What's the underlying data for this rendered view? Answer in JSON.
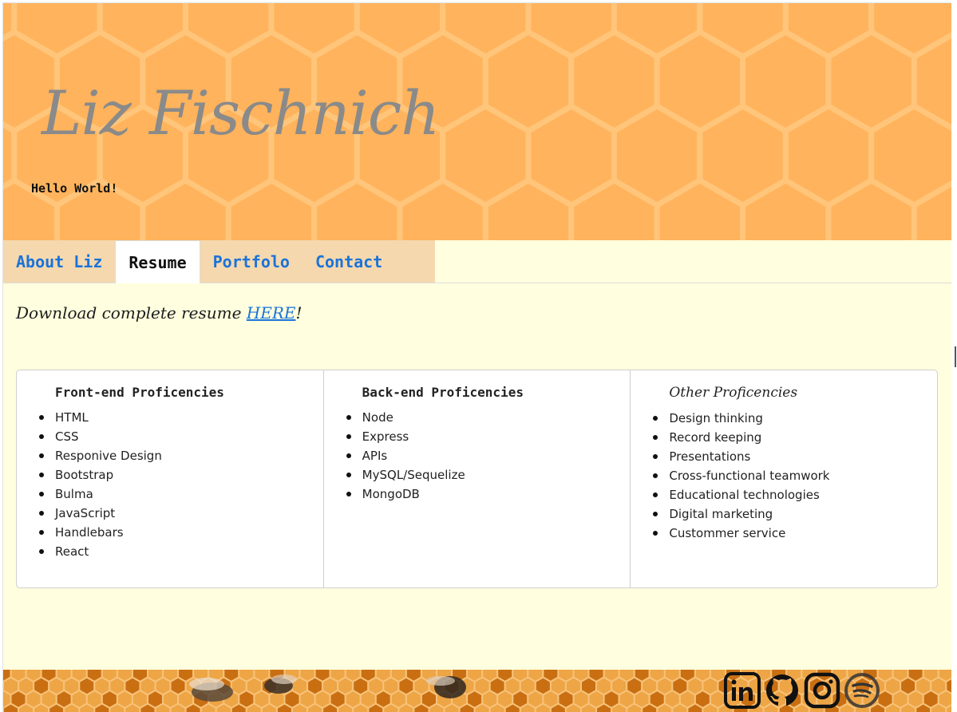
{
  "header": {
    "title": "Liz Fischnich",
    "subtitle": "Hello World!",
    "background_color": "#ffb35c"
  },
  "nav": {
    "tabs": [
      {
        "label": "About Liz",
        "active": false
      },
      {
        "label": "Resume",
        "active": true
      },
      {
        "label": "Portfolo",
        "active": false
      },
      {
        "label": "Contact",
        "active": false
      }
    ]
  },
  "resume": {
    "download_prefix": "Download complete resume ",
    "download_link": "HERE",
    "download_suffix": "!",
    "columns": [
      {
        "heading": "Front-end Proficencies",
        "items": [
          "HTML",
          "CSS",
          "Responive Design",
          "Bootstrap",
          "Bulma",
          "JavaScript",
          "Handlebars",
          "React"
        ]
      },
      {
        "heading": "Back-end Proficencies",
        "items": [
          "Node",
          "Express",
          "APIs",
          "MySQL/Sequelize",
          "MongoDB"
        ]
      },
      {
        "heading": "Other Proficencies",
        "items": [
          "Design thinking",
          "Record keeping",
          "Presentations",
          "Cross-functional teamwork",
          "Educational technologies",
          "Digital marketing",
          "Custommer service"
        ]
      }
    ]
  },
  "footer": {
    "social_icons": [
      "linkedin-icon",
      "github-icon",
      "instagram-icon",
      "spotify-icon"
    ]
  },
  "colors": {
    "page_bg": "#ffffdf",
    "tab_bar": "#f5d8ae",
    "link": "#1a73d9"
  }
}
